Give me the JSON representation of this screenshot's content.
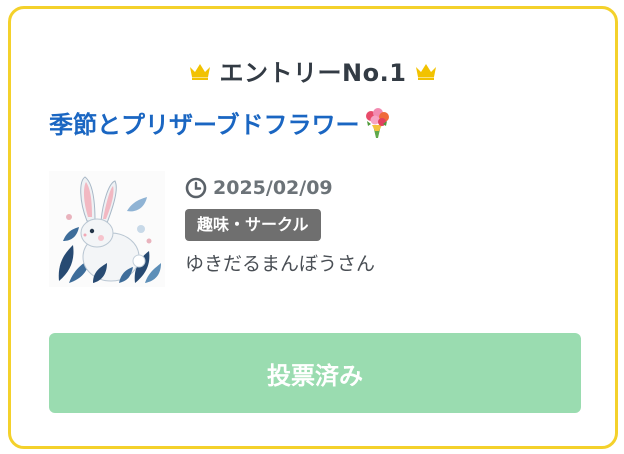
{
  "entry": {
    "label": "エントリーNo.1"
  },
  "post": {
    "title": "季節とプリザーブドフラワー",
    "title_emoji_icon": "bouquet-icon",
    "date": "2025/02/09",
    "category": "趣味・サークル",
    "author": "ゆきだるまんぼうさん",
    "thumbnail_icon": "rabbit-illustration"
  },
  "vote_button": {
    "label": "投票済み"
  },
  "colors": {
    "card_border": "#f4d12b",
    "crown": "#f2c200",
    "title": "#1a66c2",
    "heading": "#333b44",
    "badge_bg": "#6f6f6f",
    "button_bg": "#9adcb0",
    "meta_text": "#6c7378"
  }
}
